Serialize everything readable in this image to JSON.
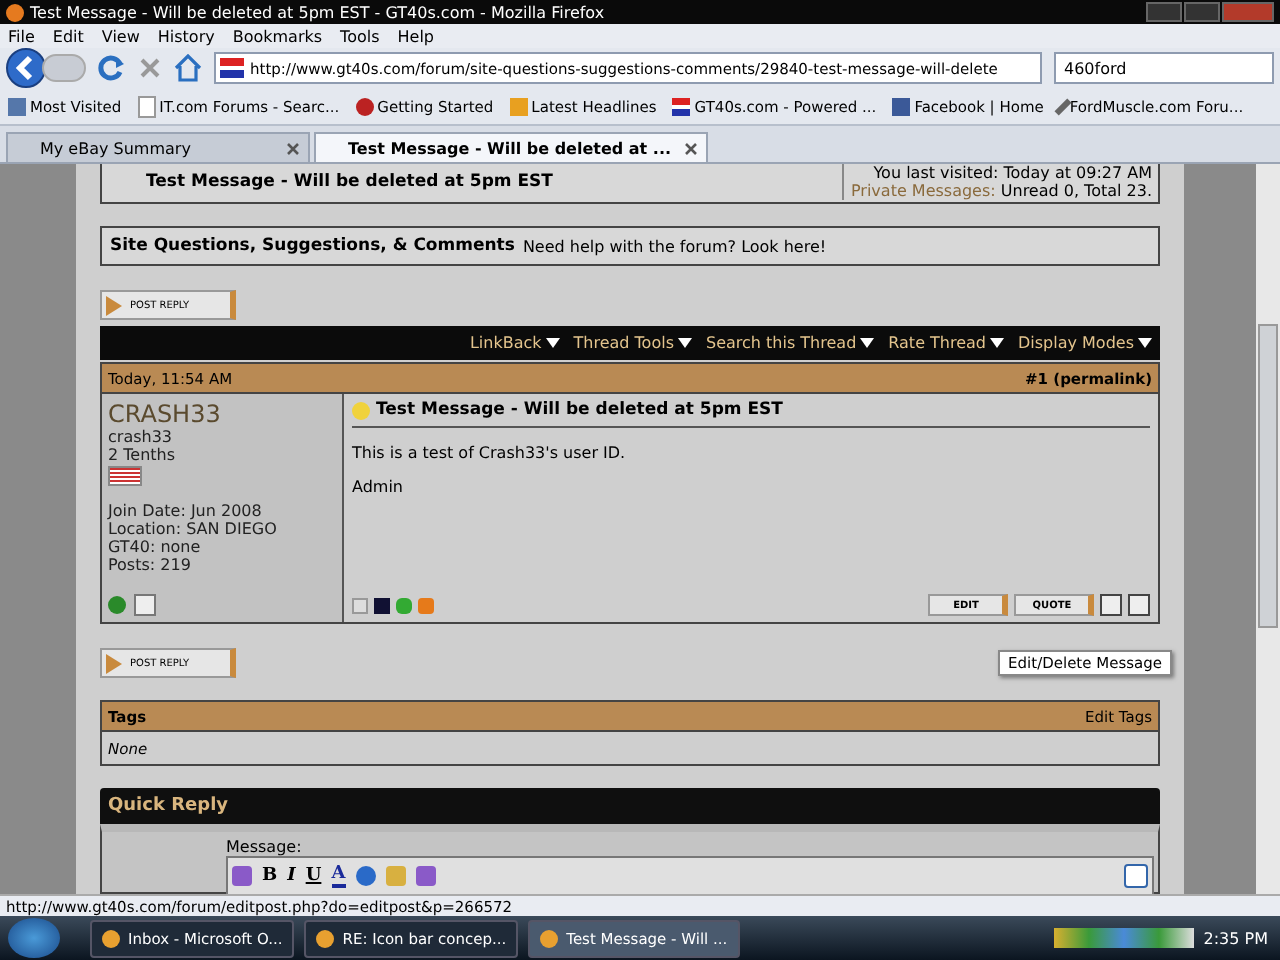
{
  "window": {
    "title": "Test Message - Will be deleted at 5pm EST - GT40s.com - Mozilla Firefox"
  },
  "menu": [
    "File",
    "Edit",
    "View",
    "History",
    "Bookmarks",
    "Tools",
    "Help"
  ],
  "address": {
    "value": "http://www.gt40s.com/forum/site-questions-suggestions-comments/29840-test-message-will-delete"
  },
  "search": {
    "value": "460ford"
  },
  "bookmarks": [
    {
      "label": "Most Visited",
      "kind": "star"
    },
    {
      "label": "IT.com Forums - Searc...",
      "kind": "page"
    },
    {
      "label": "Getting Started",
      "kind": "bird"
    },
    {
      "label": "Latest Headlines",
      "kind": "feed"
    },
    {
      "label": "GT40s.com - Powered ...",
      "kind": "logo"
    },
    {
      "label": "Facebook | Home",
      "kind": "fb"
    },
    {
      "label": "FordMuscle.com Foru...",
      "kind": "tool"
    }
  ],
  "tabs": [
    {
      "label": "My eBay Summary",
      "selected": false
    },
    {
      "label": "Test Message - Will be deleted at ...",
      "selected": true
    }
  ],
  "top_box": {
    "title": "Test Message - Will be deleted at 5pm EST",
    "last_visited": "You last visited: Today at 09:27 AM",
    "pm_label": "Private Messages:",
    "pm_value": "Unread 0, Total 23."
  },
  "forum_box": {
    "name": "Site Questions, Suggestions, & Comments",
    "description": "Need help with the forum? Look here!"
  },
  "post_reply": [
    "POST REPLY",
    "POST REPLY"
  ],
  "thread_tools": [
    "LinkBack",
    "Thread Tools",
    "Search this Thread",
    "Rate Thread",
    "Display Modes"
  ],
  "post": {
    "date": "Today, 11:54 AM",
    "number": "#1",
    "permalink": "(permalink)",
    "username": "CRASH33",
    "user_title": "crash33",
    "rank": "2 Tenths",
    "details": [
      "Join Date: Jun 2008",
      "Location: SAN DIEGO",
      "GT40: none",
      "Posts: 219"
    ],
    "online": true,
    "title": "Test Message - Will be deleted at 5pm EST",
    "body": [
      "This is a test of Crash33's user ID.",
      "Admin"
    ],
    "buttons": [
      "EDIT",
      "QUOTE"
    ]
  },
  "tooltip": "Edit/Delete Message",
  "tags": {
    "title": "Tags",
    "edit": "Edit Tags",
    "value": "None"
  },
  "quick_reply": {
    "title": "Quick Reply",
    "label": "Message:",
    "tools": [
      {
        "kind": "text",
        "label": "B"
      },
      {
        "kind": "text",
        "label": "I"
      },
      {
        "kind": "text",
        "label": "U"
      },
      {
        "kind": "text",
        "label": "A"
      }
    ]
  },
  "status_bar": "http://www.gt40s.com/forum/editpost.php?do=editpost&p=266572",
  "taskbar": {
    "items": [
      {
        "label": "Inbox - Microsoft O...",
        "selected": false
      },
      {
        "label": "RE: Icon bar concep...",
        "selected": false
      },
      {
        "label": "Test Message - Will ...",
        "selected": true
      }
    ],
    "clock": "2:35 PM"
  }
}
